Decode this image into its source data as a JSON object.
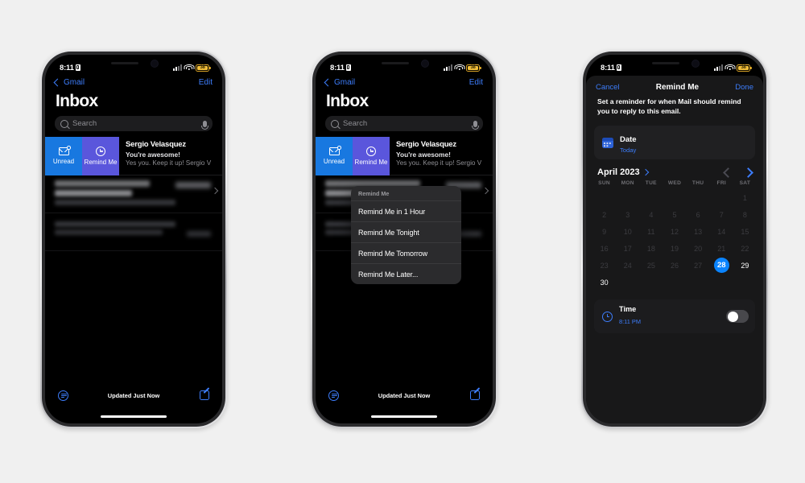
{
  "background_color": "#f0f0f0",
  "status_bar": {
    "time": "8:11",
    "lock_icon": "lock-icon",
    "signal_icon": "cellular-signal-icon",
    "wifi_icon": "wifi-icon",
    "battery_icon": "battery-icon",
    "battery_percent": "38"
  },
  "mail": {
    "back_label": "Gmail",
    "edit_label": "Edit",
    "title": "Inbox",
    "search_placeholder": "Search",
    "mic_icon": "microphone-icon",
    "search_icon": "search-icon",
    "swipe_actions": [
      {
        "label": "Unread",
        "icon": "envelope-badge-icon",
        "color": "#1878e0"
      },
      {
        "label": "Remind Me",
        "icon": "clock-icon",
        "color": "#5a56dc"
      }
    ],
    "email": {
      "sender": "Sergio Velasquez",
      "subject": "You're awesome!",
      "preview": "Yes you. Keep it up! Sergio V"
    },
    "toolbar": {
      "filter_icon": "filter-icon",
      "status": "Updated Just Now",
      "compose_icon": "compose-icon"
    }
  },
  "context_menu": {
    "header": "Remind Me",
    "items": [
      "Remind Me in 1 Hour",
      "Remind Me Tonight",
      "Remind Me Tomorrow",
      "Remind Me Later..."
    ]
  },
  "remind_sheet": {
    "cancel_label": "Cancel",
    "title": "Remind Me",
    "done_label": "Done",
    "description": "Set a reminder for when Mail should remind you to reply to this email.",
    "date_card": {
      "icon": "calendar-icon",
      "label": "Date",
      "value": "Today"
    },
    "calendar": {
      "month_label": "April 2023",
      "month_chevron_icon": "chevron-right-icon",
      "prev_icon": "chevron-left-icon",
      "next_icon": "chevron-right-icon",
      "weekdays": [
        "SUN",
        "MON",
        "TUE",
        "WED",
        "THU",
        "FRI",
        "SAT"
      ],
      "leading_blanks": 6,
      "days": [
        1,
        2,
        3,
        4,
        5,
        6,
        7,
        8,
        9,
        10,
        11,
        12,
        13,
        14,
        15,
        16,
        17,
        18,
        19,
        20,
        21,
        22,
        23,
        24,
        25,
        26,
        27,
        28,
        29,
        30
      ],
      "selected_day": 28,
      "future_days": [
        29,
        30
      ],
      "selected_color": "#0a84ff"
    },
    "time_row": {
      "icon": "clock-icon",
      "label": "Time",
      "value": "8:11 PM",
      "toggle_state": "off"
    }
  }
}
